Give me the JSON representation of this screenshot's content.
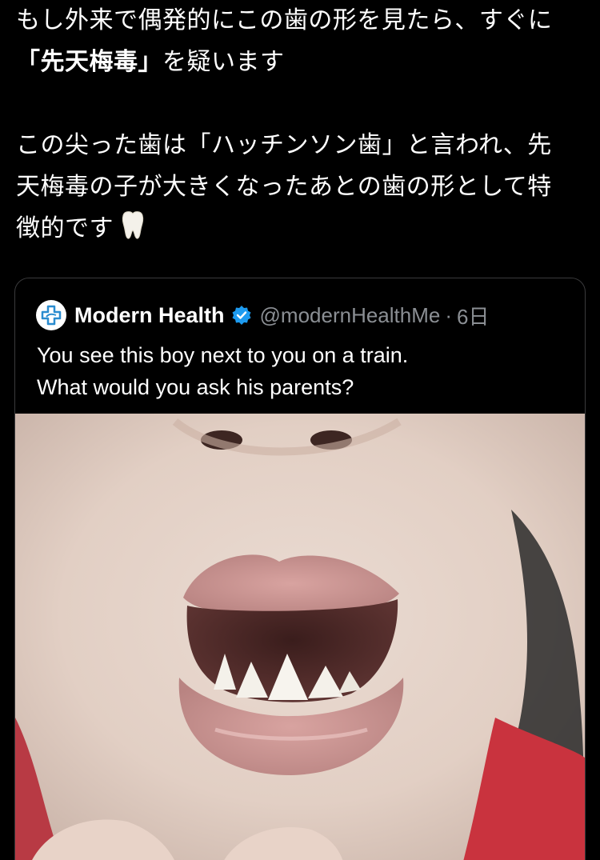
{
  "post": {
    "lines": [
      "もし外来で偶発的にこの歯の形を見たら、すぐに",
      "を疑います",
      "この尖った歯は「ハッチンソン歯」と言われ、先",
      "天梅毒の子が大きくなったあとの歯の形として特",
      "徴的です"
    ],
    "bold_term": "「先天梅毒」",
    "emoji": "tooth-emoji"
  },
  "quoted_tweet": {
    "display_name": "Modern Health",
    "handle": "@modernHealthMe",
    "separator": "·",
    "time": "6日",
    "verified": true,
    "text_lines": [
      "You see this boy next to you on a train.",
      "What would you ask his parents?"
    ],
    "image_alt": "photo-of-child-mouth-with-pointed-teeth"
  },
  "colors": {
    "background": "#000000",
    "text": "#ffffff",
    "muted": "#8b8f94",
    "border": "#3a3a3c",
    "verified": "#1d9bf0"
  }
}
